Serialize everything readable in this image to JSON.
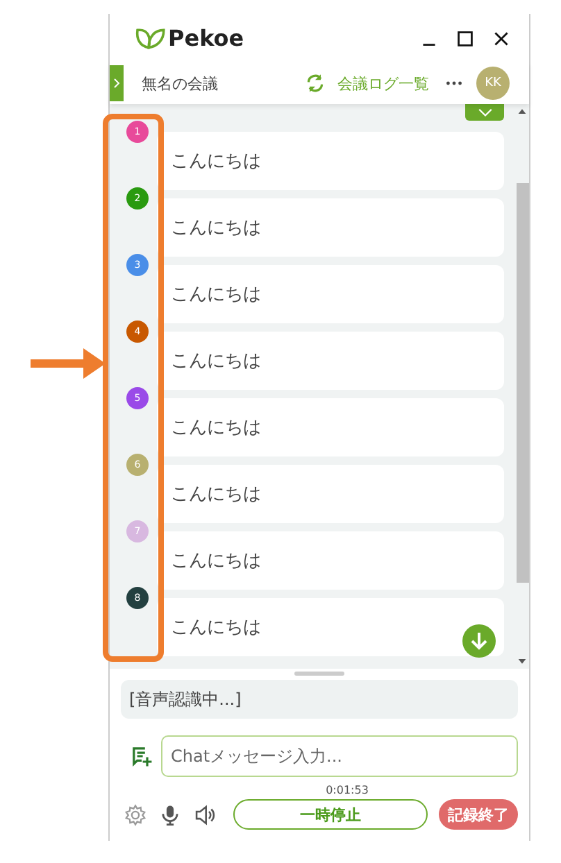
{
  "window": {
    "app_name": "Pekoe"
  },
  "header": {
    "meeting_title": "無名の会議",
    "log_link": "会議ログ一覧",
    "avatar_initials": "KK"
  },
  "messages": [
    {
      "speaker": "1",
      "color": "#e84a9a",
      "text": "こんにちは"
    },
    {
      "speaker": "2",
      "color": "#2a9a10",
      "text": "こんにちは"
    },
    {
      "speaker": "3",
      "color": "#4a8ee8",
      "text": "こんにちは"
    },
    {
      "speaker": "4",
      "color": "#c85800",
      "text": "こんにちは"
    },
    {
      "speaker": "5",
      "color": "#9a4ae8",
      "text": "こんにちは"
    },
    {
      "speaker": "6",
      "color": "#b8b070",
      "text": "こんにちは"
    },
    {
      "speaker": "7",
      "color": "#d8b8e0",
      "text": "こんにちは"
    },
    {
      "speaker": "8",
      "color": "#234040",
      "text": "こんにちは"
    }
  ],
  "recognition": {
    "status": "[音声認識中...]"
  },
  "chat_input": {
    "placeholder": "Chatメッセージ入力..."
  },
  "timer": "0:01:53",
  "buttons": {
    "pause": "一時停止",
    "stop": "記録終了"
  }
}
